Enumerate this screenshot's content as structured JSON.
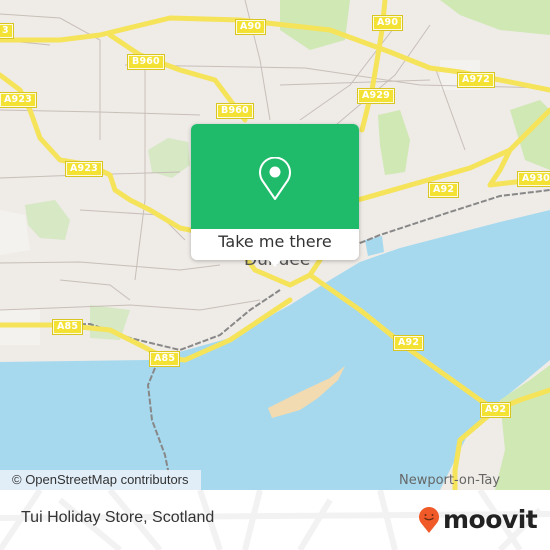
{
  "map": {
    "road_labels": [
      {
        "id": "a90-left",
        "text": "A90"
      },
      {
        "id": "a90-right",
        "text": "A90"
      },
      {
        "id": "b960-top",
        "text": "B960"
      },
      {
        "id": "b960-mid",
        "text": "B960"
      },
      {
        "id": "a923-top",
        "text": "A923"
      },
      {
        "id": "a923-mid",
        "text": "A923"
      },
      {
        "id": "a929",
        "text": "A929"
      },
      {
        "id": "a972",
        "text": "A972"
      },
      {
        "id": "a92-east",
        "text": "A92"
      },
      {
        "id": "a930",
        "text": "A930"
      },
      {
        "id": "a85-west",
        "text": "A85"
      },
      {
        "id": "a85-south",
        "text": "A85"
      },
      {
        "id": "a92-bridge",
        "text": "A92"
      },
      {
        "id": "a92-newport",
        "text": "A92"
      },
      {
        "id": "edge-a9x",
        "text": "3"
      }
    ],
    "place_labels": {
      "city": "Dundee",
      "town": "Newport-on-Tay"
    },
    "colors": {
      "land": "#efebe7",
      "water": "#a6d9ee",
      "park": "#cfe8b4",
      "road_major": "#f5e35a",
      "sandbank": "#f2dbb0",
      "brand_green": "#1fba6a",
      "moovit_orange": "#f05a28"
    }
  },
  "popup": {
    "icon": "map-pin-icon",
    "button_label": "Take me there"
  },
  "attribution": "© OpenStreetMap contributors",
  "footer": {
    "place_name": "Tui Holiday Store, Scotland",
    "brand": "moovit",
    "brand_icon": "moovit-smiley-pin-icon"
  }
}
